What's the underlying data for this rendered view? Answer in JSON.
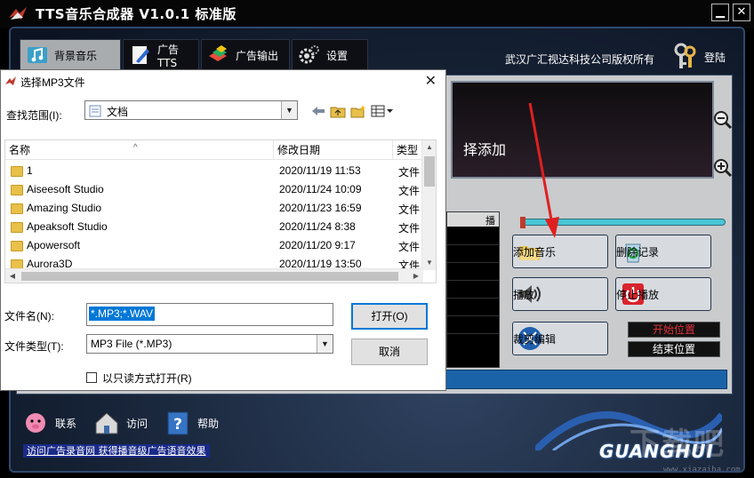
{
  "app": {
    "title": "TTS音乐合成器 V1.0.1 标准版",
    "window_buttons": {
      "minimize": "▁",
      "close": "✕"
    },
    "nav_tabs": [
      {
        "label": "背景音乐",
        "icon": "music-note-icon",
        "active": true
      },
      {
        "label": "广告TTS",
        "icon": "pen-paper-icon",
        "active": false
      },
      {
        "label": "广告输出",
        "icon": "colorful-cubes-icon",
        "active": false
      },
      {
        "label": "设置",
        "icon": "gears-icon",
        "active": false
      }
    ],
    "copyright": "武汉广汇视达科技公司版权所有",
    "login_label": "登陆",
    "screen_text": "择添加",
    "grid_header": "播",
    "buttons": {
      "add_music": "添加音乐",
      "delete_record": "删除记录",
      "play": "播放",
      "stop": "停止播放",
      "trim_edit": "裁剪编辑",
      "start_position": "开始位置",
      "end_position": "结束位置"
    },
    "footer": {
      "contact": "联系",
      "visit": "访问",
      "help": "帮助",
      "links": "访问广告录音网 获得播音级广告语音效果"
    },
    "brand": "GUANGHUI",
    "watermark": "下载吧",
    "watermark_url": "www.xiazaiba.com",
    "colors": {
      "progress": "#49c6d6",
      "start_position_text": "#e0303a",
      "link_bar": "#1a2a88",
      "arrow": "#e02020"
    }
  },
  "dialog": {
    "title": "选择MP3文件",
    "look_in_label": "查找范围(I):",
    "look_in_value": "文档",
    "columns": [
      "名称",
      "修改日期",
      "类型"
    ],
    "rows": [
      {
        "name": "1",
        "date": "2020/11/19 11:53",
        "type": "文件"
      },
      {
        "name": "Aiseesoft Studio",
        "date": "2020/11/24 10:09",
        "type": "文件"
      },
      {
        "name": "Amazing Studio",
        "date": "2020/11/23 16:59",
        "type": "文件"
      },
      {
        "name": "Apeaksoft Studio",
        "date": "2020/11/24 8:38",
        "type": "文件"
      },
      {
        "name": "Apowersoft",
        "date": "2020/11/20 9:17",
        "type": "文件"
      },
      {
        "name": "Aurora3D",
        "date": "2020/11/19 13:50",
        "type": "文件"
      }
    ],
    "filename_label": "文件名(N):",
    "filename_value": "*.MP3;*.WAV",
    "filetype_label": "文件类型(T):",
    "filetype_value": "MP3 File (*.MP3)",
    "open_button": "打开(O)",
    "cancel_button": "取消",
    "readonly_label": "以只读方式打开(R)",
    "readonly_checked": false
  }
}
